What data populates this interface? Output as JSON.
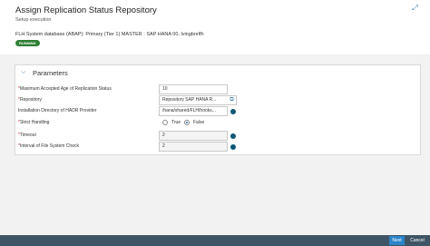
{
  "header": {
    "title": "Assign Replication Status Repository",
    "subtitle": "Setup execution",
    "system_info": "FLH System database (ABAP): Primary (Tier 1) MASTER : SAP HANA 00, lvingbnrlfh",
    "status_badge": "RUNNING"
  },
  "panel": {
    "title": "Parameters",
    "fields": {
      "max_age": {
        "label": "Maximum Accepted Age of Replication Status",
        "required": "*",
        "value": "10"
      },
      "repository": {
        "label": "Repository",
        "required": "*",
        "value": "Repository SAP HANA R..."
      },
      "install_dir": {
        "label": "Installation Directory of HADR Provider",
        "value": "/hana/shared/FLH/hooks..."
      },
      "strict": {
        "label": "Strict Handling",
        "required": "*",
        "option_true": "True",
        "option_false": "False",
        "selected": "False"
      },
      "timeout": {
        "label": "Timeout",
        "required": "*",
        "value": "2"
      },
      "interval": {
        "label": "Interval of File System Check",
        "required": "*",
        "value": "2"
      }
    }
  },
  "footer": {
    "next_label": "Next",
    "cancel_label": "Cancel"
  },
  "icons": {
    "expand": "expand-icon",
    "collapse": "chevron-down-icon",
    "value_help": "value-help-icon",
    "info": "info-dot-icon"
  },
  "colors": {
    "accent": "#3b78ab",
    "status_running": "#2e7d32",
    "footer_bg": "#3f5565",
    "next_button": "#2a85c8",
    "info_dot": "#0b5774",
    "required": "#c62828"
  }
}
